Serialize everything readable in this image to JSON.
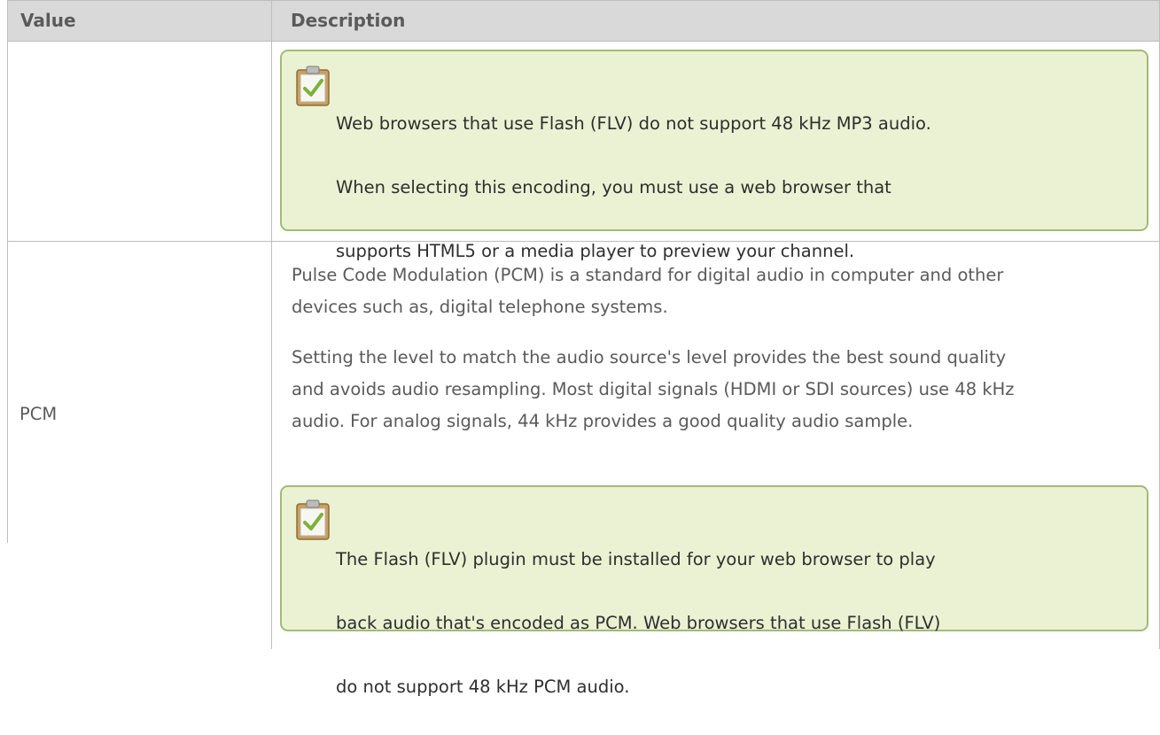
{
  "table": {
    "headers": {
      "value": "Value",
      "description": "Description"
    },
    "rows": [
      {
        "value": "",
        "note": {
          "icon": "clipboard-check-icon",
          "lines": [
            "Web browsers that use Flash (FLV) do not support 48 kHz MP3 audio.",
            "When selecting this encoding, you must use a web browser that",
            "supports HTML5 or a media player to preview your channel."
          ]
        }
      },
      {
        "value": "PCM",
        "paragraph1": [
          "Pulse Code Modulation (PCM) is a standard for digital audio in computer and other",
          "devices such as, digital telephone systems."
        ],
        "paragraph2": [
          "Setting the level to match the audio source's level provides the best sound quality",
          "and avoids audio resampling. Most digital signals (HDMI or SDI sources) use 48 kHz",
          "audio. For analog signals, 44 kHz provides a good quality audio sample."
        ],
        "note": {
          "icon": "clipboard-check-icon",
          "lines": [
            "The Flash (FLV) plugin must be installed for your web browser to play",
            "back audio that's encoded as PCM. Web browsers that use Flash (FLV)",
            "do not support 48 kHz PCM audio."
          ]
        }
      }
    ]
  },
  "colors": {
    "header_bg": "#d9d9d9",
    "note_bg": "#ebf2d3",
    "note_border": "#a3ba76",
    "grid": "#bdbdbd"
  }
}
